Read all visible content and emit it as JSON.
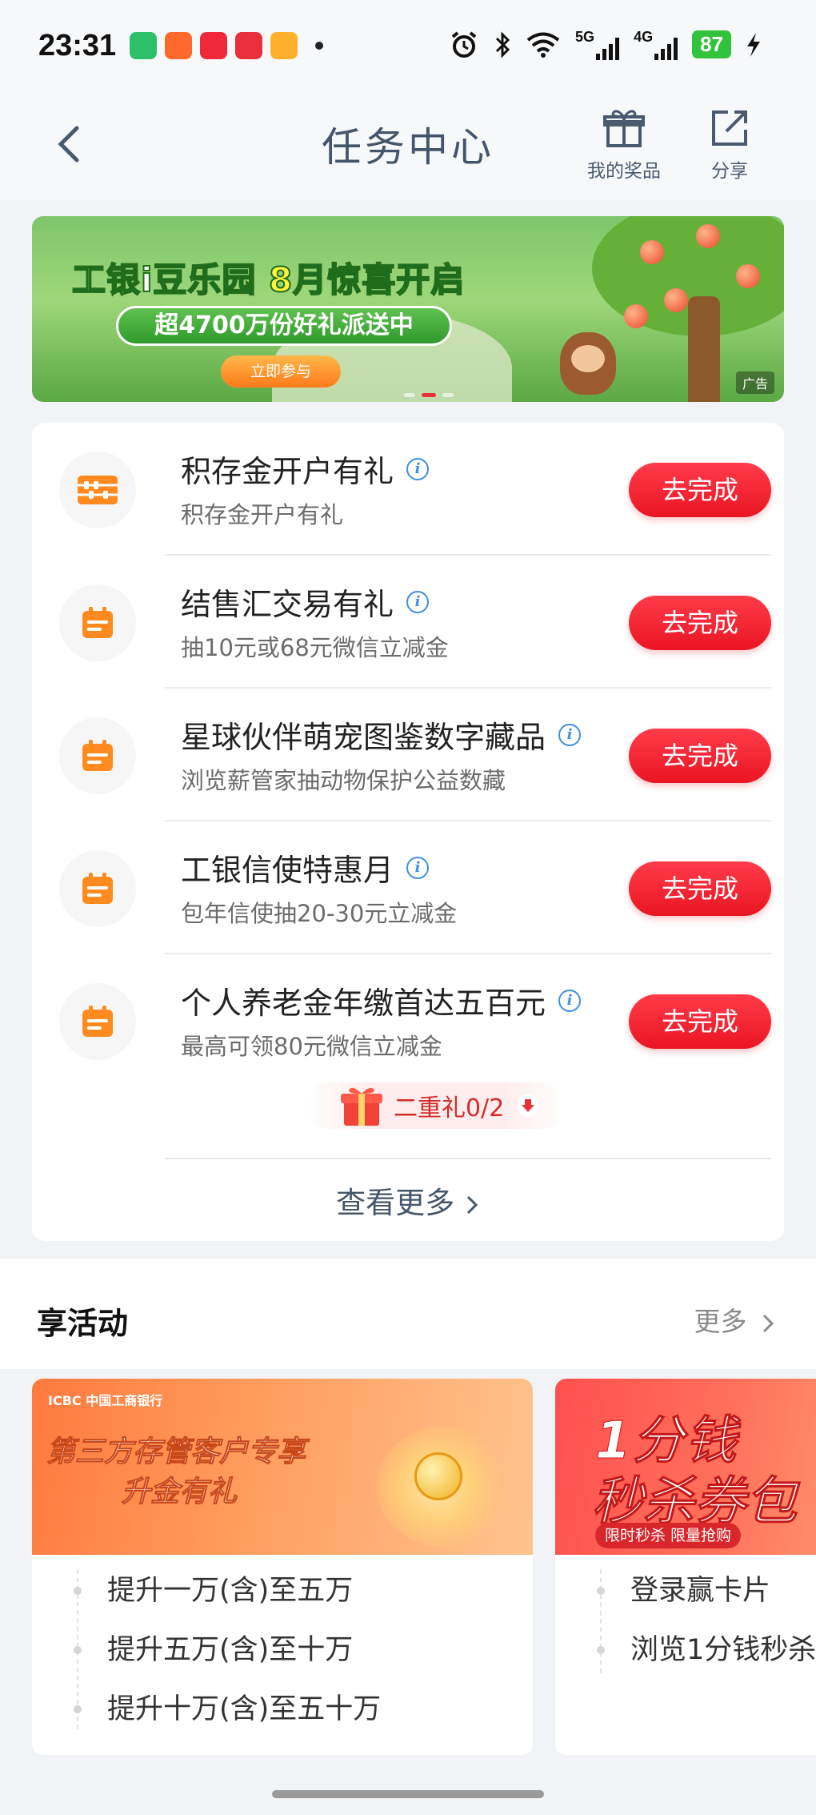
{
  "status_bar": {
    "time": "23:31",
    "network_5g": "5G",
    "network_4g": "4G",
    "battery": "87"
  },
  "header": {
    "title": "任务中心",
    "prizes_label": "我的奖品",
    "share_label": "分享"
  },
  "banner": {
    "title_part1": "工银i豆乐园 ",
    "title_part2": "8月惊喜开启",
    "subtitle": "超4700万份好礼派送中",
    "cta": "立即参与",
    "ad_label": "广告"
  },
  "tasks": [
    {
      "name": "积存金开户有礼",
      "desc": "积存金开户有礼",
      "button": "去完成",
      "icon": "abacus-icon"
    },
    {
      "name": "结售汇交易有礼",
      "desc": "抽10元或68元微信立减金",
      "button": "去完成",
      "icon": "calendar-icon"
    },
    {
      "name": "星球伙伴萌宠图鉴数字藏品",
      "desc": "浏览薪管家抽动物保护公益数藏",
      "button": "去完成",
      "icon": "calendar-icon"
    },
    {
      "name": "工银信使特惠月",
      "desc": "包年信使抽20-30元立减金",
      "button": "去完成",
      "icon": "calendar-icon"
    },
    {
      "name": "个人养老金年缴首达五百元",
      "desc": "最高可领80元微信立减金",
      "button": "去完成",
      "icon": "calendar-icon"
    }
  ],
  "second_gift": "二重礼0/2",
  "view_more": "查看更多",
  "activities": {
    "title": "享活动",
    "more": "更多",
    "cards": [
      {
        "brand": "ICBC 中国工商银行",
        "headline1": "第三方存管客户专享",
        "headline2": "升金有礼",
        "items": [
          "提升一万(含)至五万",
          "提升五万(含)至十万",
          "提升十万(含)至五十万"
        ]
      },
      {
        "headline1": "1分钱",
        "headline2": "秒杀券包",
        "tag": "限时秒杀 限量抢购",
        "items": [
          "登录赢卡片",
          "浏览1分钱秒杀"
        ]
      }
    ]
  },
  "colors": {
    "accent_red": "#ea1522",
    "task_icon_orange": "#ff8a1f",
    "info_blue": "#3f8fe0",
    "header_text": "#45556a"
  }
}
